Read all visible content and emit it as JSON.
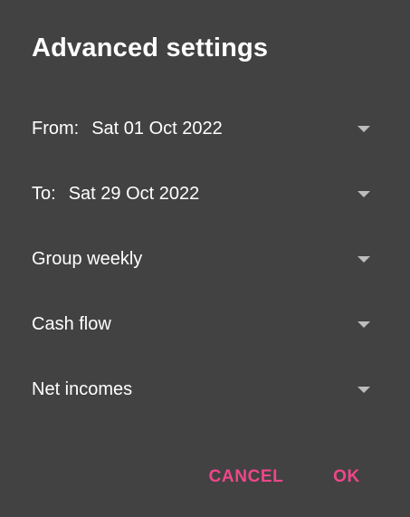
{
  "dialog": {
    "title": "Advanced settings",
    "from": {
      "label": "From:",
      "value": "Sat 01 Oct 2022"
    },
    "to": {
      "label": "To:",
      "value": "Sat 29 Oct 2022"
    },
    "grouping": {
      "value": "Group weekly"
    },
    "report_type": {
      "value": "Cash flow"
    },
    "metric": {
      "value": "Net incomes"
    },
    "cancel_label": "CANCEL",
    "ok_label": "OK",
    "icons": {
      "dropdown": "triangle-down-icon"
    },
    "colors": {
      "background": "#424242",
      "text": "#ffffff",
      "accent": "#f0468a",
      "caret": "#bdbdbd"
    }
  }
}
